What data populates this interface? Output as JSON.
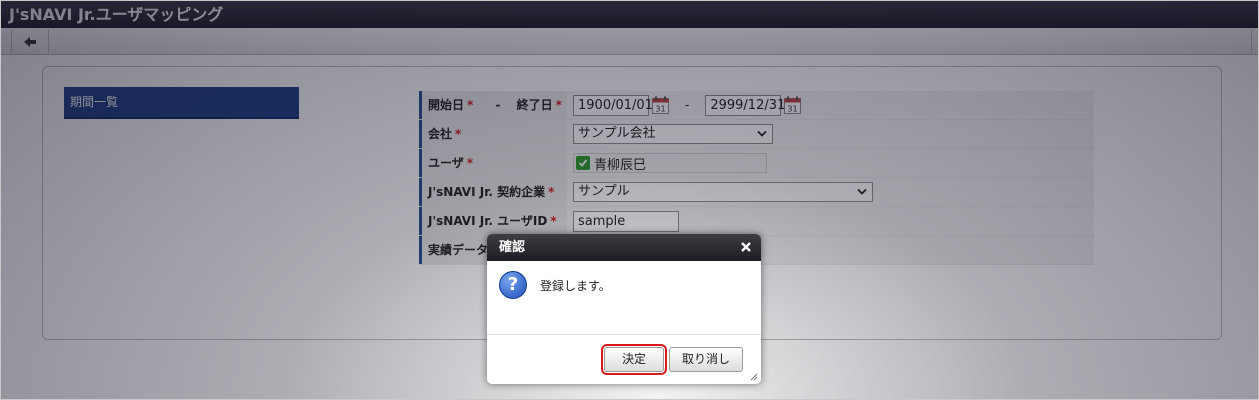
{
  "app": {
    "title": "J'sNAVI Jr.ユーザマッピング"
  },
  "sidebar": {
    "items": [
      {
        "label": "期間一覧"
      }
    ]
  },
  "form": {
    "start_label": "開始日",
    "range_sep": "-",
    "end_label": "終了日",
    "required_mark": "*",
    "start_date": "1900/01/01",
    "end_date": "2999/12/31",
    "company_label": "会社",
    "company_value": "サンプル会社",
    "user_label": "ユーザ",
    "user_value": "青柳辰巳",
    "contract_label": "J'sNAVI Jr. 契約企業",
    "contract_value": "サンプル",
    "userid_label": "J'sNAVI Jr. ユーザID",
    "userid_value": "sample",
    "record_label": "実績データ"
  },
  "dialog": {
    "title": "確認",
    "message": "登録します。",
    "ok_label": "決定",
    "cancel_label": "取り消し"
  },
  "icons": {
    "back": "arrow-left-icon",
    "calendar": "calendar-icon",
    "calendar_day": "31",
    "question": "question-icon",
    "question_glyph": "?",
    "close": "close-icon"
  },
  "colors": {
    "accent": "#1e3f86",
    "required": "#d01b1b",
    "highlight": "#d81c1c",
    "check": "#2c9a2c"
  }
}
